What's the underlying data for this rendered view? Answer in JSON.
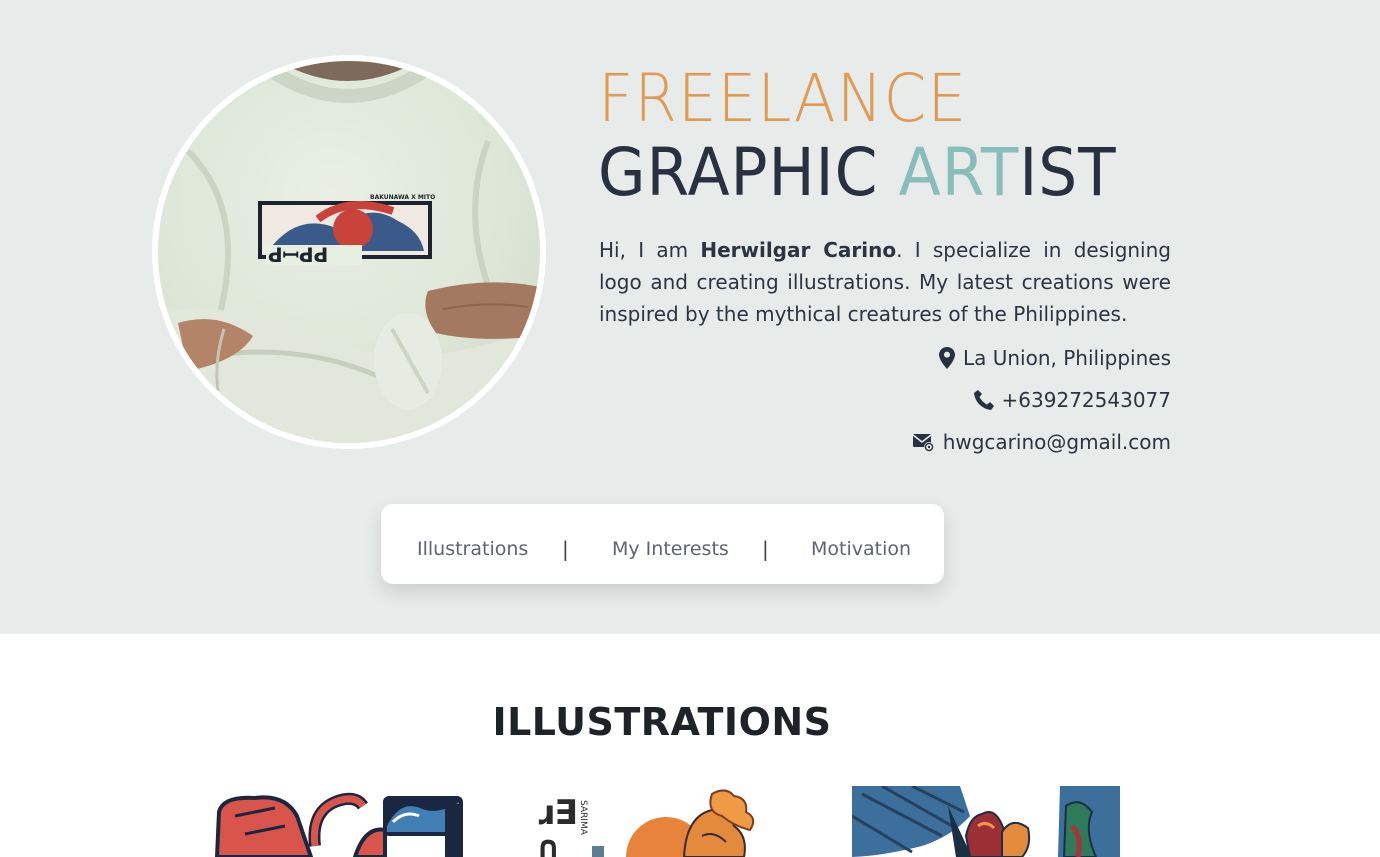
{
  "hero": {
    "title_line1": "FREELANCE",
    "title_line2_a": "GRAPHIC ",
    "title_line2_accent": "ART",
    "title_line2_b": "IST",
    "intro_prefix": "Hi, I am ",
    "intro_name": "Herwilgar Carino",
    "intro_suffix": ". I specialize in designing logo and creating illustrations. My latest creations were inspired by the mythical creatures of the Philippines.",
    "photo_alt": "profile-photo",
    "shirt_print_label": "BAKUNAWA X MITO",
    "shirt_print_caption": "ꓒꟷꓒꓒ"
  },
  "contact": {
    "location": "La Union, Philippines",
    "phone": "+639272543077",
    "email": "hwgcarino@gmail.com"
  },
  "nav": {
    "items": [
      "Illustrations",
      "My Interests",
      "Motivation"
    ],
    "separator": "|"
  },
  "illustrations": {
    "title": "ILLUSTRATIONS",
    "thumb2_text": "SARIMA"
  },
  "colors": {
    "hero_bg": "#e7ebea",
    "orange": "#e09a52",
    "dark": "#27313f",
    "teal": "#88bdb9"
  }
}
